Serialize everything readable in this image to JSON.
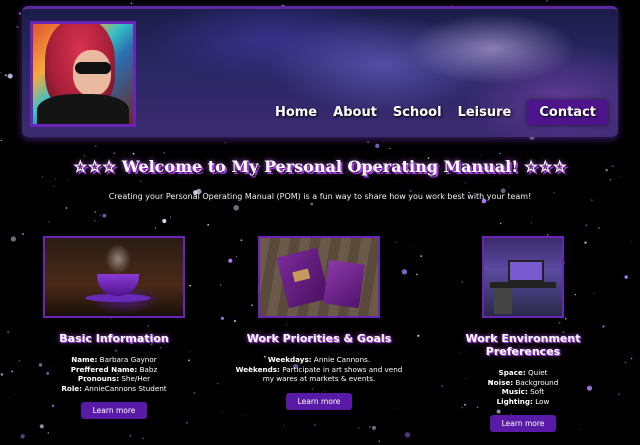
{
  "nav": {
    "items": [
      "Home",
      "About",
      "School",
      "Leisure"
    ],
    "contact": "Contact"
  },
  "hero": {
    "title": "☆☆☆ Welcome to My Personal Operating Manual! ☆☆☆",
    "intro": "Creating your Personal Operating Manual (POM) is a fun way to share how you work best with your team!"
  },
  "cards": [
    {
      "title": "Basic Information",
      "rows": [
        {
          "label": "Name:",
          "value": "Barbara Gaynor"
        },
        {
          "label": "Preffered Name:",
          "value": "Babz"
        },
        {
          "label": "Pronouns:",
          "value": "She/Her"
        },
        {
          "label": "Role:",
          "value": "AnnieCannons Student"
        }
      ],
      "button": "Learn more"
    },
    {
      "title": "Work Priorities & Goals",
      "rows": [
        {
          "label": "Weekdays:",
          "value": "Annie Cannons."
        },
        {
          "label": "Weekends:",
          "value": "Participate in art shows and vend my wares at markets & events."
        }
      ],
      "button": "Learn more"
    },
    {
      "title": "Work Environment Preferences",
      "rows": [
        {
          "label": "Space:",
          "value": "Quiet"
        },
        {
          "label": "Noise:",
          "value": "Background"
        },
        {
          "label": "Music:",
          "value": "Soft"
        },
        {
          "label": "Lighting:",
          "value": "Low"
        }
      ],
      "button": "Learn more"
    }
  ],
  "colors": {
    "accent": "#5a1aa8",
    "glow": "#a33bdd",
    "background": "#000000"
  },
  "icons": {
    "profile": "profile-photo",
    "coffee": "coffee-cup-image",
    "notebooks": "notebooks-image",
    "desk": "gaming-desk-image"
  }
}
